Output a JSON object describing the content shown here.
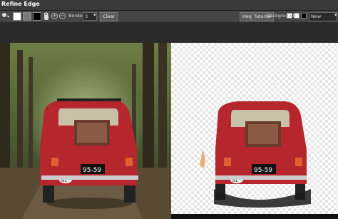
{
  "window": {
    "title": "Refine Edge"
  },
  "toolbar": {
    "brush_size": "3",
    "border_label": "Border",
    "border_value": "3",
    "clear_label": "Clear",
    "help_label": "Help",
    "tutorial_label": "Tutorial",
    "background_label": "Background",
    "layer_select_value": "New Layer"
  },
  "colors": {
    "swatch_white": "#ffffff",
    "swatch_gray": "#7a7a7a",
    "swatch_black": "#000000",
    "car_red": "#b5262d"
  },
  "images": {
    "left_plate": "95-59",
    "left_badge": "NL",
    "right_plate": "95-59",
    "right_badge": "NL"
  }
}
